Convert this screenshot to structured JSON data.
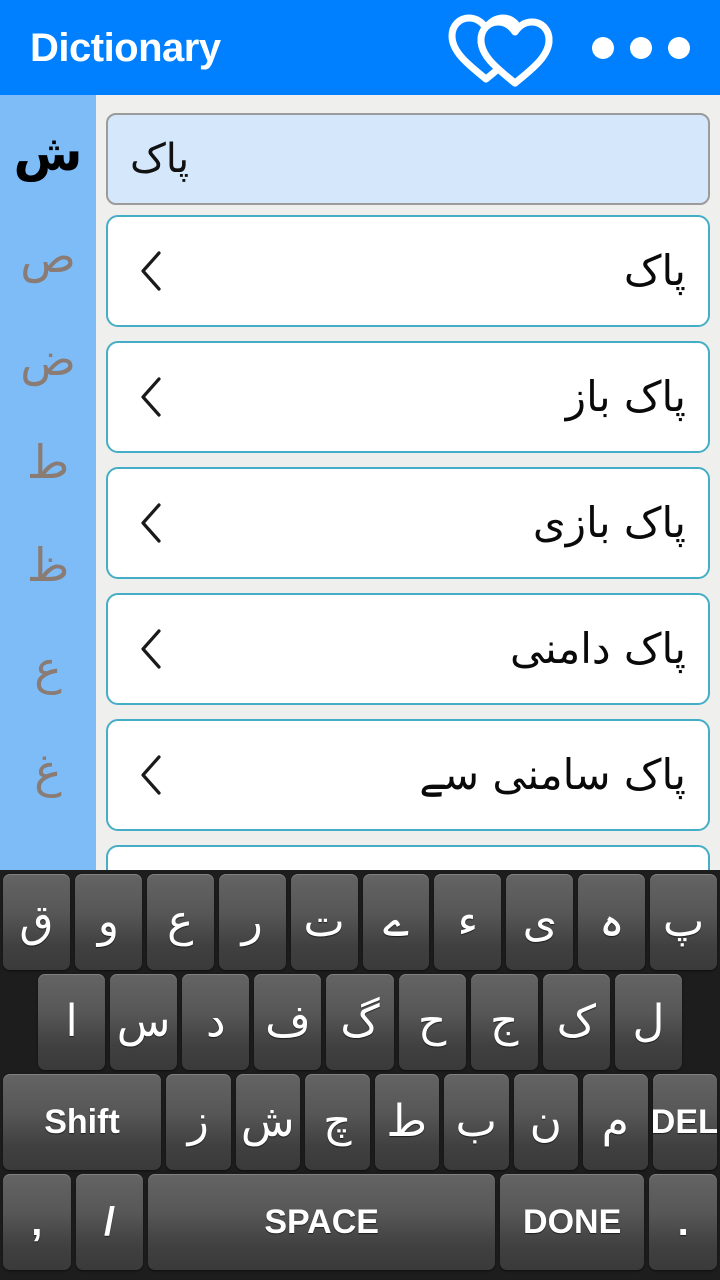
{
  "header": {
    "title": "Dictionary",
    "favorites_icon": "double-heart-icon",
    "overflow_icon": "three-dots-icon",
    "bg_color": "#0080ff"
  },
  "sidebar": {
    "bg_color": "#7dbcf7",
    "active_color": "#000000",
    "inactive_color": "#8a7b74",
    "letters": [
      {
        "label": "ش",
        "active": true
      },
      {
        "label": "ص",
        "active": false
      },
      {
        "label": "ض",
        "active": false
      },
      {
        "label": "ط",
        "active": false
      },
      {
        "label": "ظ",
        "active": false
      },
      {
        "label": "ع",
        "active": false
      },
      {
        "label": "غ",
        "active": false
      }
    ]
  },
  "search": {
    "value": "پاک",
    "placeholder": "",
    "bg_color": "#d5e8fb",
    "border_color": "#9b9b9b"
  },
  "results": {
    "card_border_color": "#45aec6",
    "chevron_icon": "chevron-left-icon",
    "items": [
      {
        "word": "پاک"
      },
      {
        "word": "پاک باز"
      },
      {
        "word": "پاک بازی"
      },
      {
        "word": "پاک دامنی"
      },
      {
        "word": "پاک سامنی سے"
      },
      {
        "word": ""
      }
    ]
  },
  "keyboard": {
    "bg_color": "#1d1d1d",
    "key_color": "#575757",
    "rows": [
      {
        "indent": false,
        "keys": [
          {
            "label": "ق",
            "kind": "urdu"
          },
          {
            "label": "و",
            "kind": "urdu"
          },
          {
            "label": "ع",
            "kind": "urdu"
          },
          {
            "label": "ر",
            "kind": "urdu"
          },
          {
            "label": "ت",
            "kind": "urdu"
          },
          {
            "label": "ے",
            "kind": "urdu"
          },
          {
            "label": "ء",
            "kind": "urdu"
          },
          {
            "label": "ی",
            "kind": "urdu"
          },
          {
            "label": "ہ",
            "kind": "urdu"
          },
          {
            "label": "پ",
            "kind": "urdu"
          }
        ]
      },
      {
        "indent": true,
        "keys": [
          {
            "label": "ا",
            "kind": "urdu"
          },
          {
            "label": "س",
            "kind": "urdu"
          },
          {
            "label": "د",
            "kind": "urdu"
          },
          {
            "label": "ف",
            "kind": "urdu"
          },
          {
            "label": "گ",
            "kind": "urdu"
          },
          {
            "label": "ح",
            "kind": "urdu"
          },
          {
            "label": "ج",
            "kind": "urdu"
          },
          {
            "label": "ک",
            "kind": "urdu"
          },
          {
            "label": "ل",
            "kind": "urdu"
          }
        ]
      },
      {
        "indent": false,
        "keys": [
          {
            "label": "Shift",
            "kind": "latin",
            "size": "wide-shift"
          },
          {
            "label": "ز",
            "kind": "urdu"
          },
          {
            "label": "ش",
            "kind": "urdu"
          },
          {
            "label": "چ",
            "kind": "urdu"
          },
          {
            "label": "ط",
            "kind": "urdu"
          },
          {
            "label": "ب",
            "kind": "urdu"
          },
          {
            "label": "ن",
            "kind": "urdu"
          },
          {
            "label": "م",
            "kind": "urdu"
          },
          {
            "label": "DEL",
            "kind": "latin"
          }
        ]
      },
      {
        "indent": false,
        "keys": [
          {
            "label": ",",
            "kind": "punct",
            "size": "narrow"
          },
          {
            "label": "/",
            "kind": "punct",
            "size": "narrow"
          },
          {
            "label": "SPACE",
            "kind": "latin",
            "size": "wide-space"
          },
          {
            "label": "DONE",
            "kind": "latin",
            "size": "wide-done"
          },
          {
            "label": ".",
            "kind": "punct",
            "size": "narrow"
          }
        ]
      }
    ]
  }
}
